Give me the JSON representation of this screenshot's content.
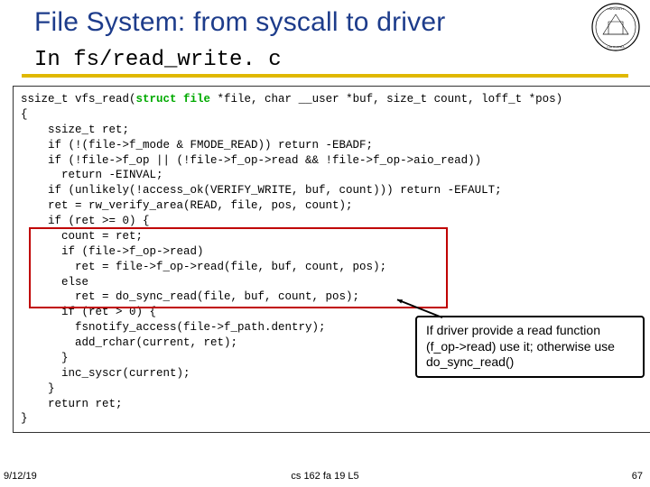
{
  "header": {
    "title": "File System: from syscall to driver",
    "subtitle": "In fs/read_write. c"
  },
  "code": {
    "lines": [
      {
        "t": "ssize_t vfs_read(",
        "h": "struct file",
        "t2": " *file, char __user *buf, size_t count, loff_t *pos)",
        "hl": true
      },
      {
        "t": "{"
      },
      {
        "t": "    ssize_t ret;"
      },
      {
        "t": "    if (!(file->f_mode & FMODE_READ)) return -EBADF;"
      },
      {
        "t": "    if (!file->f_op || (!file->f_op->read && !file->f_op->aio_read))"
      },
      {
        "t": "      return -EINVAL;"
      },
      {
        "t": "    if (unlikely(!access_ok(VERIFY_WRITE, buf, count))) return -EFAULT;"
      },
      {
        "t": "    ret = rw_verify_area(READ, file, pos, count);"
      },
      {
        "t": "    if (ret >= 0) {"
      },
      {
        "t": "      count = ret;"
      },
      {
        "t": "      if (file->f_op->read)"
      },
      {
        "t": "        ret = file->f_op->read(file, buf, count, pos);"
      },
      {
        "t": "      else"
      },
      {
        "t": "        ret = do_sync_read(file, buf, count, pos);"
      },
      {
        "t": "      if (ret > 0) {"
      },
      {
        "t": "        fsnotify_access(file->f_path.dentry);"
      },
      {
        "t": "        add_rchar(current, ret);"
      },
      {
        "t": "      }"
      },
      {
        "t": "      inc_syscr(current);"
      },
      {
        "t": "    }"
      },
      {
        "t": "    return ret;"
      },
      {
        "t": "}"
      }
    ]
  },
  "callout": {
    "text": "If driver provide a read function (f_op->read) use it; otherwise use do_sync_read()"
  },
  "footer": {
    "date": "9/12/19",
    "center": "cs 162 fa 19 L5",
    "page": "67"
  },
  "colors": {
    "titleBlue": "#1d3c8b",
    "underlineYellow": "#e0b800",
    "highlightRed": "#c00000"
  }
}
